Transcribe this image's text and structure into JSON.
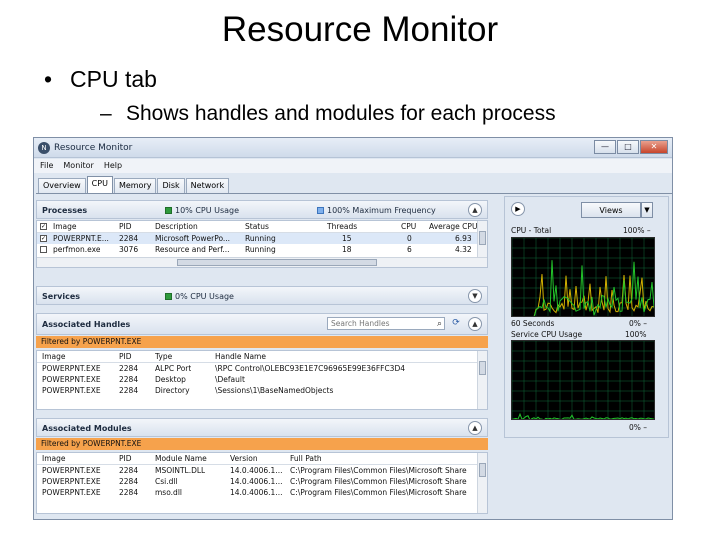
{
  "slide": {
    "title": "Resource Monitor",
    "bullet1": "CPU tab",
    "bullet2": "Shows handles and modules for each process",
    "bullet1_marker": "•",
    "bullet2_marker": "–"
  },
  "window": {
    "title": "Resource Monitor",
    "app_icon_glyph": "N",
    "minimize": "—",
    "maximize": "□",
    "close": "✕"
  },
  "menu": [
    "File",
    "Monitor",
    "Help"
  ],
  "tabs": [
    "Overview",
    "CPU",
    "Memory",
    "Disk",
    "Network"
  ],
  "processes": {
    "title": "Processes",
    "cpu_usage": "10% CPU Usage",
    "max_freq": "100% Maximum Frequency",
    "columns": [
      "Image",
      "PID",
      "Description",
      "Status",
      "Threads",
      "CPU",
      "Average CPU"
    ],
    "rows": [
      {
        "checked": true,
        "image": "POWERPNT.E...",
        "pid": "2284",
        "description": "Microsoft PowerPo...",
        "status": "Running",
        "threads": "15",
        "cpu": "0",
        "avg": "6.93"
      },
      {
        "checked": false,
        "image": "perfmon.exe",
        "pid": "3076",
        "description": "Resource and Perf...",
        "status": "Running",
        "threads": "18",
        "cpu": "6",
        "avg": "4.32"
      }
    ]
  },
  "services": {
    "title": "Services",
    "cpu_usage": "0% CPU Usage"
  },
  "handles": {
    "title": "Associated Handles",
    "search_placeholder": "Search Handles",
    "filter": "Filtered by POWERPNT.EXE",
    "columns": [
      "Image",
      "PID",
      "Type",
      "Handle Name"
    ],
    "rows": [
      {
        "image": "POWERPNT.EXE",
        "pid": "2284",
        "type": "ALPC Port",
        "name": "\\RPC Control\\OLEBC93E1E7C96965E99E36FFC3D4"
      },
      {
        "image": "POWERPNT.EXE",
        "pid": "2284",
        "type": "Desktop",
        "name": "\\Default"
      },
      {
        "image": "POWERPNT.EXE",
        "pid": "2284",
        "type": "Directory",
        "name": "\\Sessions\\1\\BaseNamedObjects"
      }
    ]
  },
  "modules": {
    "title": "Associated Modules",
    "filter": "Filtered by POWERPNT.EXE",
    "columns": [
      "Image",
      "PID",
      "Module Name",
      "Version",
      "Full Path"
    ],
    "rows": [
      {
        "image": "POWERPNT.EXE",
        "pid": "2284",
        "module": "MSOINTL.DLL",
        "version": "14.0.4006.1...",
        "path": "C:\\Program Files\\Common Files\\Microsoft Share"
      },
      {
        "image": "POWERPNT.EXE",
        "pid": "2284",
        "module": "Csi.dll",
        "version": "14.0.4006.1...",
        "path": "C:\\Program Files\\Common Files\\Microsoft Share"
      },
      {
        "image": "POWERPNT.EXE",
        "pid": "2284",
        "module": "mso.dll",
        "version": "14.0.4006.1...",
        "path": "C:\\Program Files\\Common Files\\Microsoft Share"
      }
    ]
  },
  "right_panel": {
    "views": "Views",
    "cpu_total_label": "CPU - Total",
    "cpu_total_max": "100%",
    "cpu_total_min": "0%",
    "time_span": "60 Seconds",
    "service_label": "Service CPU Usage",
    "service_max": "100%",
    "service_min": "0%",
    "dash": "–"
  },
  "colors": {
    "graph_green": "#22c32a",
    "graph_yellow": "#d2b000",
    "graph_grid": "#0f6a3a",
    "filter_orange": "#f6a24c"
  }
}
